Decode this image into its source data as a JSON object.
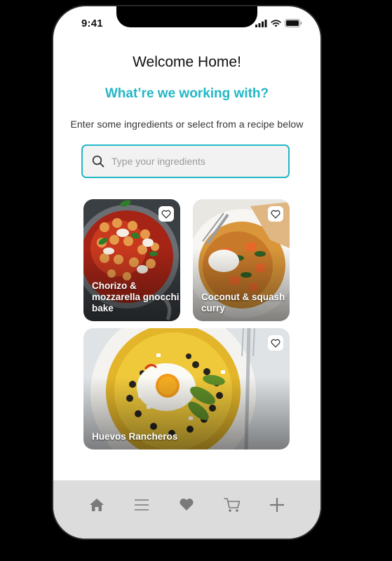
{
  "status_bar": {
    "time": "9:41"
  },
  "header": {
    "welcome": "Welcome Home!",
    "subtitle": "What’re we working with?",
    "instruction": "Enter some ingredients or select from a recipe below"
  },
  "search": {
    "placeholder": "Type your ingredients",
    "value": ""
  },
  "recipes": [
    {
      "title": "Chorizo & mozzarella gnocchi bake",
      "favorite": false
    },
    {
      "title": "Coconut & squash curry",
      "favorite": false
    },
    {
      "title": "Huevos Rancheros",
      "favorite": false
    }
  ],
  "tab_bar": {
    "items": [
      "home-icon",
      "list-icon",
      "heart-icon",
      "cart-icon",
      "plus-icon"
    ]
  },
  "colors": {
    "accent": "#22b7c6",
    "tab_bar_bg": "#dcdcdc",
    "icon": "#7a7a7a"
  }
}
